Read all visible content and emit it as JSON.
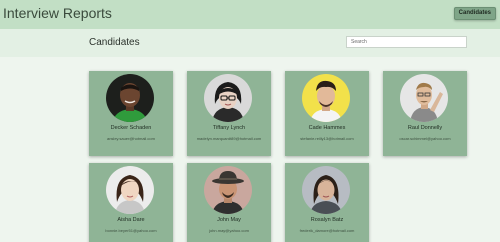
{
  "header": {
    "title": "Interview Reports",
    "nav_button": "Candidates"
  },
  "page": {
    "title": "Candidates",
    "search_placeholder": "Search"
  },
  "candidates": [
    {
      "name": "Decker Schaden",
      "email": "ansley.sauer@hotmail.com"
    },
    {
      "name": "Tiffany Lynch",
      "email": "madelyn.marquardt89@hotmail.com"
    },
    {
      "name": "Cade Hammes",
      "email": "stefanie.reilly13@hotmail.com"
    },
    {
      "name": "Raul Donnelly",
      "email": "oscar.schimmel@yahoo.com"
    },
    {
      "name": "Aisha Dare",
      "email": "bonnie.beyer51@yahoo.com"
    },
    {
      "name": "John May",
      "email": "john.may@yahoo.com"
    },
    {
      "name": "Rosalyn Batz",
      "email": "frederik_damore@hotmail.com"
    }
  ]
}
